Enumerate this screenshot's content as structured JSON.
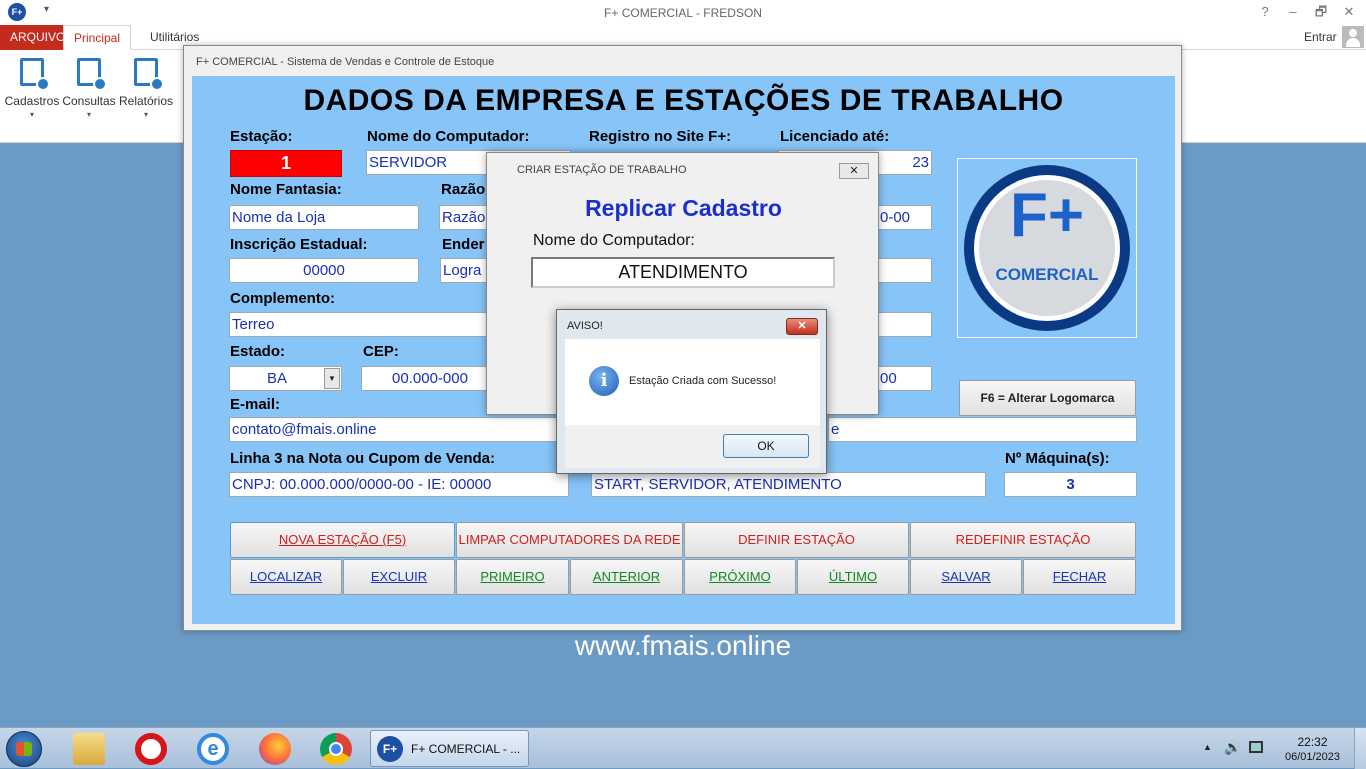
{
  "app": {
    "window_title": "F+ COMERCIAL - FREDSON",
    "logo_small": "F+",
    "winbuttons": [
      "?",
      "–",
      "🗗",
      "✕"
    ]
  },
  "ribbon": {
    "tabs": [
      "ARQUIVO",
      "Principal",
      "Utilitários"
    ],
    "signin": "Entrar",
    "buttons": [
      {
        "label": "Cadastros",
        "icon": "cadastros-icon"
      },
      {
        "label": "Consultas",
        "icon": "consultas-icon"
      },
      {
        "label": "Relatórios",
        "icon": "relatorios-icon"
      }
    ]
  },
  "form": {
    "window_title": "F+ COMERCIAL - Sistema de Vendas e Controle de Estoque",
    "title": "DADOS DA EMPRESA E ESTAÇÕES DE TRABALHO",
    "labels": {
      "estacao": "Estação:",
      "nome_computador": "Nome do Computador:",
      "registro": "Registro no Site F+:",
      "licenciado": "Licenciado até:",
      "nome_fantasia": "Nome Fantasia:",
      "razao": "Razão",
      "inscricao": "Inscrição Estadual:",
      "endereco": "Ender",
      "complemento": "Complemento:",
      "estado": "Estado:",
      "cep": "CEP:",
      "email": "E-mail:",
      "linha3": "Linha 3 na Nota ou Cupom de Venda:",
      "maquinas": "Nº Máquina(s):"
    },
    "values": {
      "estacao": "1",
      "nome_computador": "SERVIDOR",
      "licenciado": "23",
      "nome_fantasia": "Nome da Loja",
      "razao": "Razão",
      "cnpj_partial": "0-00",
      "inscricao": "00000",
      "endereco": "Logra",
      "complemento": "Terreo",
      "estado": "BA",
      "cep": "00.000-000",
      "fone_partial": "00",
      "email": "contato@fmais.online",
      "site_partial": "e",
      "linha3": "CNPJ: 00.000.000/0000-00 - IE: 00000",
      "computadores": "START, SERVIDOR, ATENDIMENTO",
      "maquinas": "3"
    },
    "logo": {
      "big": "F+",
      "text": "COMERCIAL"
    },
    "logo_button": "F6 = Alterar Logomarca",
    "buttons_row1": [
      "NOVA ESTAÇÃO (F5)",
      "LIMPAR COMPUTADORES DA REDE",
      "DEFINIR ESTAÇÃO",
      "REDEFINIR ESTAÇÃO"
    ],
    "buttons_row2": [
      "LOCALIZAR",
      "EXCLUIR",
      "PRIMEIRO",
      "ANTERIOR",
      "PRÓXIMO",
      "ÚLTIMO",
      "SALVAR",
      "FECHAR"
    ]
  },
  "dialog_criar": {
    "title": "CRIAR ESTAÇÃO DE TRABALHO",
    "close": "✕",
    "heading": "Replicar Cadastro",
    "label": "Nome do Computador:",
    "value": "ATENDIMENTO"
  },
  "dialog_aviso": {
    "title": "AVISO!",
    "close": "✕",
    "icon_glyph": "i",
    "message": "Estação Criada com Sucesso!",
    "ok": "OK"
  },
  "website": "www.fmais.online",
  "taskbar": {
    "app_label": "F+ COMERCIAL - ...",
    "app_icon": "F+",
    "tray_arrow": "▲",
    "tray_sound": "🔊",
    "time": "22:32",
    "date": "06/01/2023"
  },
  "colors": {
    "form_bg": "#87c4f7",
    "estacao_bg": "#ff0000",
    "field_text": "#1a2fb5",
    "accent_red": "#c42b1c"
  }
}
